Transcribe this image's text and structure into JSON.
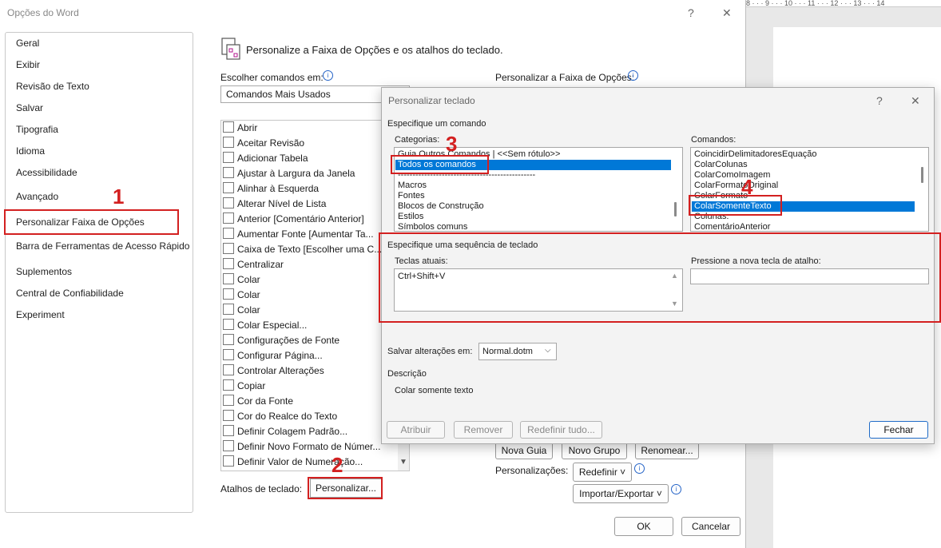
{
  "background": {
    "ruler_marks": "8 · · · 9 · · · 10 · · · 11 · · · 12 · · · 13 · · · 14"
  },
  "options_dialog": {
    "title": "Opções do Word",
    "help_glyph": "?",
    "close_glyph": "✕",
    "nav_items": [
      "Geral",
      "Exibir",
      "Revisão de Texto",
      "Salvar",
      "Tipografia",
      "Idioma",
      "Acessibilidade",
      "Avançado",
      "Personalizar Faixa de Opções",
      "Barra de Ferramentas de Acesso Rápido",
      "Suplementos",
      "Central de Confiabilidade",
      "Experiment"
    ],
    "heading": "Personalize a Faixa de Opções e os atalhos do teclado.",
    "choose_label": "Escolher comandos em:",
    "choose_value": "Comandos Mais Usados",
    "ribbon_label": "Personalizar a Faixa de Opções:",
    "commands": [
      "Abrir",
      "Aceitar Revisão",
      "Adicionar Tabela",
      "Ajustar à Largura da Janela",
      "Alinhar à Esquerda",
      "Alterar Nível de Lista",
      "Anterior [Comentário Anterior]",
      "Aumentar Fonte [Aumentar Ta...",
      "Caixa de Texto [Escolher uma C...",
      "Centralizar",
      "Colar",
      "Colar",
      "Colar",
      "Colar Especial...",
      "Configurações de Fonte",
      "Configurar Página...",
      "Controlar Alterações",
      "Copiar",
      "Cor da Fonte",
      "Cor do Realce do Texto",
      "Definir Colagem Padrão...",
      "Definir Novo Formato de Númer...",
      "Definir Valor de Numeração..."
    ],
    "shortcuts_label": "Atalhos de teclado:",
    "customize_button": "Personalizar...",
    "new_tab": "Nova Guia",
    "new_group": "Novo Grupo",
    "rename": "Renomear...",
    "customizations_label": "Personalizações:",
    "reset": "Redefinir ˅",
    "import_export": "Importar/Exportar ˅",
    "ok": "OK",
    "cancel": "Cancelar"
  },
  "keyboard_dialog": {
    "title": "Personalizar teclado",
    "help_glyph": "?",
    "close_glyph": "✕",
    "specify_command": "Especifique um comando",
    "categories_label": "Categorias:",
    "categories": [
      "Guia Outros Comandos | <<Sem rótulo>>",
      "Todos os comandos",
      "-----------------------------------------------",
      "Macros",
      "Fontes",
      "Blocos de Construção",
      "Estilos",
      "Símbolos comuns"
    ],
    "commands_label": "Comandos:",
    "commands": [
      "CoincidirDelimitadoresEquação",
      "ColarColunas",
      "ColarComoImagem",
      "ColarFormatoOriginal",
      "ColarFormato",
      "ColarSomenteTexto",
      "Colunas:",
      "ComentárioAnterior"
    ],
    "specify_sequence": "Especifique uma sequência de teclado",
    "current_keys_label": "Teclas atuais:",
    "current_keys": "Ctrl+Shift+V",
    "new_key_label": "Pressione a nova tecla de atalho:",
    "save_changes_label": "Salvar alterações em:",
    "save_changes_value": "Normal.dotm",
    "description_label": "Descrição",
    "description": "Colar somente texto",
    "assign": "Atribuir",
    "remove": "Remover",
    "reset_all": "Redefinir tudo...",
    "close": "Fechar"
  },
  "annotations": {
    "step1": "1",
    "step2": "2",
    "step3": "3",
    "step4": "4",
    "color": "#d32020"
  }
}
